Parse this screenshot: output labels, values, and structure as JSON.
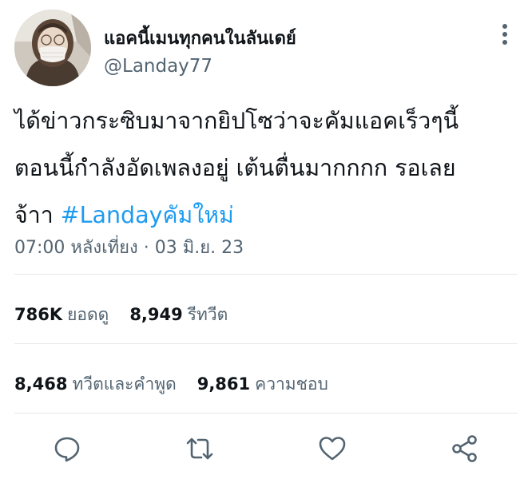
{
  "author": {
    "display_name": "แอคนี้เมนทุกคนในลันเดย์",
    "handle": "@Landay77",
    "avatar_icon": "profile-photo-masked-person"
  },
  "tweet": {
    "lines": [
      "ได้ข่าวกระซิบมาจากยิปโซว่าจะคัมแอคเร็วๆนี้",
      "ตอนนี้กำลังอัดเพลงอยู่ เต้นตื่นมากกกก รอเลย"
    ],
    "last_line_prefix": "จ้าา ",
    "hashtag": "#Landayคัมใหม่",
    "timestamp": "07:00 หลังเที่ยง · 03 มิ.ย. 23"
  },
  "stats": {
    "views": {
      "count": "786K",
      "label": "ยอดดู"
    },
    "retweets": {
      "count": "8,949",
      "label": "รีทวีต"
    },
    "quotes": {
      "count": "8,468",
      "label": "ทวีตและคำพูด"
    },
    "likes": {
      "count": "9,861",
      "label": "ความชอบ"
    }
  },
  "actions": [
    "reply-icon",
    "retweet-icon",
    "like-icon",
    "share-icon"
  ],
  "colors": {
    "accent": "#1d9bf0",
    "text": "#0f1419",
    "secondary": "#536471",
    "divider": "#e6e8ea"
  }
}
